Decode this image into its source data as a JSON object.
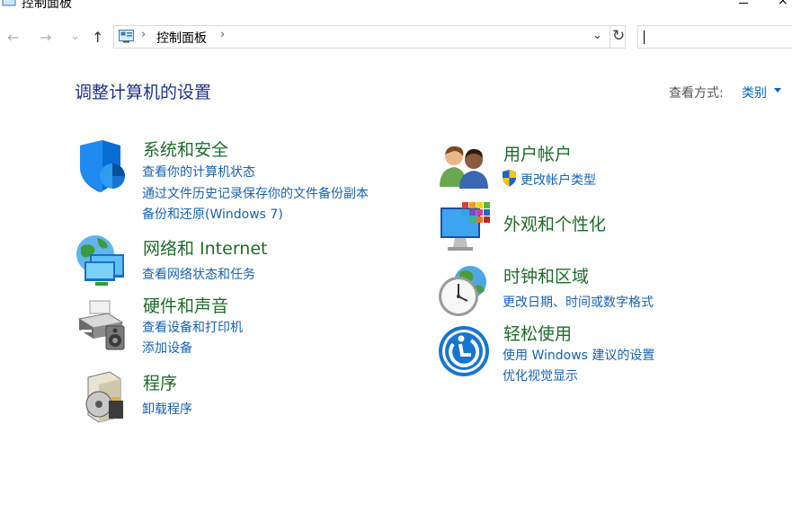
{
  "window": {
    "title": "控制面板",
    "close_glyph": "×"
  },
  "nav": {
    "back": "←",
    "forward": "→",
    "recent": "⌄",
    "up": "↑"
  },
  "address": {
    "separator": "›",
    "breadcrumb": "控制面板",
    "dropdown": "⌄",
    "refresh": "↻"
  },
  "search": {
    "value": ""
  },
  "page": {
    "heading": "调整计算机的设置",
    "view_by_label": "查看方式:",
    "view_by_value": "类别"
  },
  "categories": [
    {
      "icon": "shield-icon",
      "title": "系统和安全",
      "links": [
        "查看你的计算机状态",
        "通过文件历史记录保存你的文件备份副本",
        "备份和还原(Windows 7)"
      ]
    },
    {
      "icon": "network-globe-icon",
      "title": "网络和 Internet",
      "links": [
        "查看网络状态和任务"
      ]
    },
    {
      "icon": "printer-icon",
      "title": "硬件和声音",
      "links": [
        "查看设备和打印机",
        "添加设备"
      ]
    },
    {
      "icon": "programs-icon",
      "title": "程序",
      "links": [
        "卸载程序"
      ]
    },
    {
      "icon": "users-icon",
      "title": "用户帐户",
      "links": [
        "更改帐户类型"
      ]
    },
    {
      "icon": "monitor-palette-icon",
      "title": "外观和个性化",
      "links": []
    },
    {
      "icon": "clock-globe-icon",
      "title": "时钟和区域",
      "links": [
        "更改日期、时间或数字格式"
      ]
    },
    {
      "icon": "ease-of-access-icon",
      "title": "轻松使用",
      "links": [
        "使用 Windows 建议的设置",
        "优化视觉显示"
      ]
    }
  ],
  "colors": {
    "heading": "#1e3287",
    "category_title": "#1d6c2a",
    "link": "#1662b5"
  }
}
